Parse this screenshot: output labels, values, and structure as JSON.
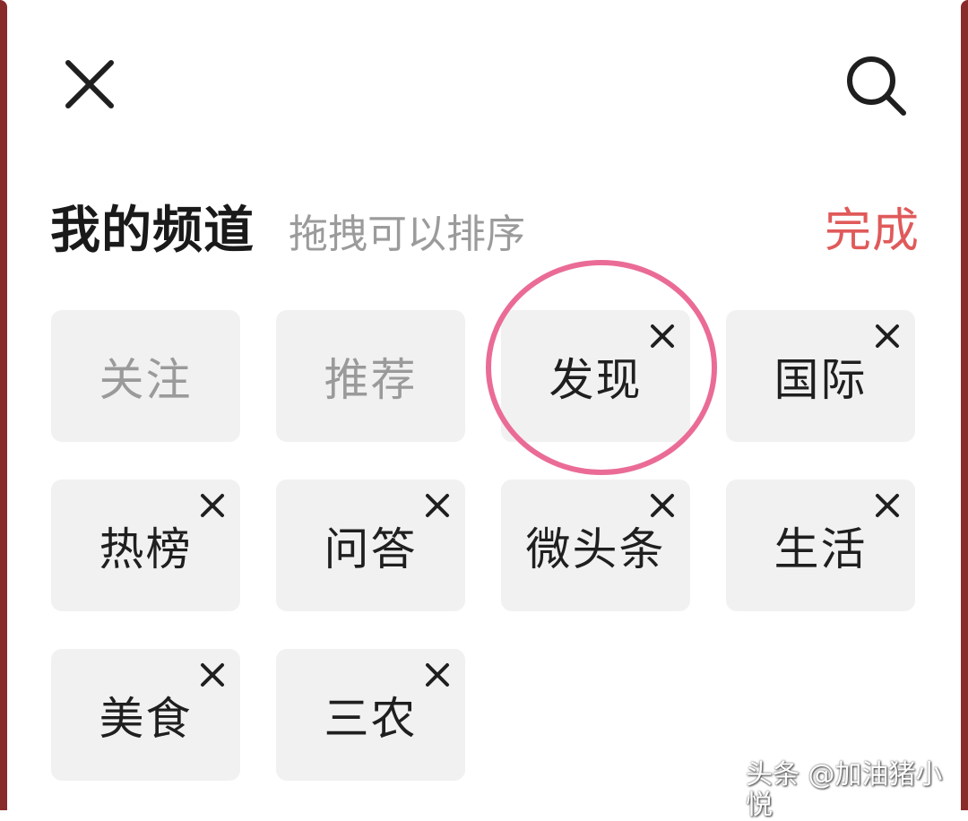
{
  "header": {
    "title": "我的频道",
    "hint": "拖拽可以排序",
    "done_label": "完成"
  },
  "channels": [
    {
      "label": "关注",
      "removable": false
    },
    {
      "label": "推荐",
      "removable": false
    },
    {
      "label": "发现",
      "removable": true
    },
    {
      "label": "国际",
      "removable": true
    },
    {
      "label": "热榜",
      "removable": true
    },
    {
      "label": "问答",
      "removable": true
    },
    {
      "label": "微头条",
      "removable": true
    },
    {
      "label": "生活",
      "removable": true
    },
    {
      "label": "美食",
      "removable": true
    },
    {
      "label": "三农",
      "removable": true
    }
  ],
  "icons": {
    "close": "close-icon",
    "search": "search-icon",
    "remove": "remove-icon"
  },
  "colors": {
    "accent": "#e05a5a",
    "highlight": "#ea6c96",
    "tile_bg": "#f1f1f1",
    "muted_text": "#9a9a9a"
  },
  "watermark": "头条 @加油猪小悦"
}
